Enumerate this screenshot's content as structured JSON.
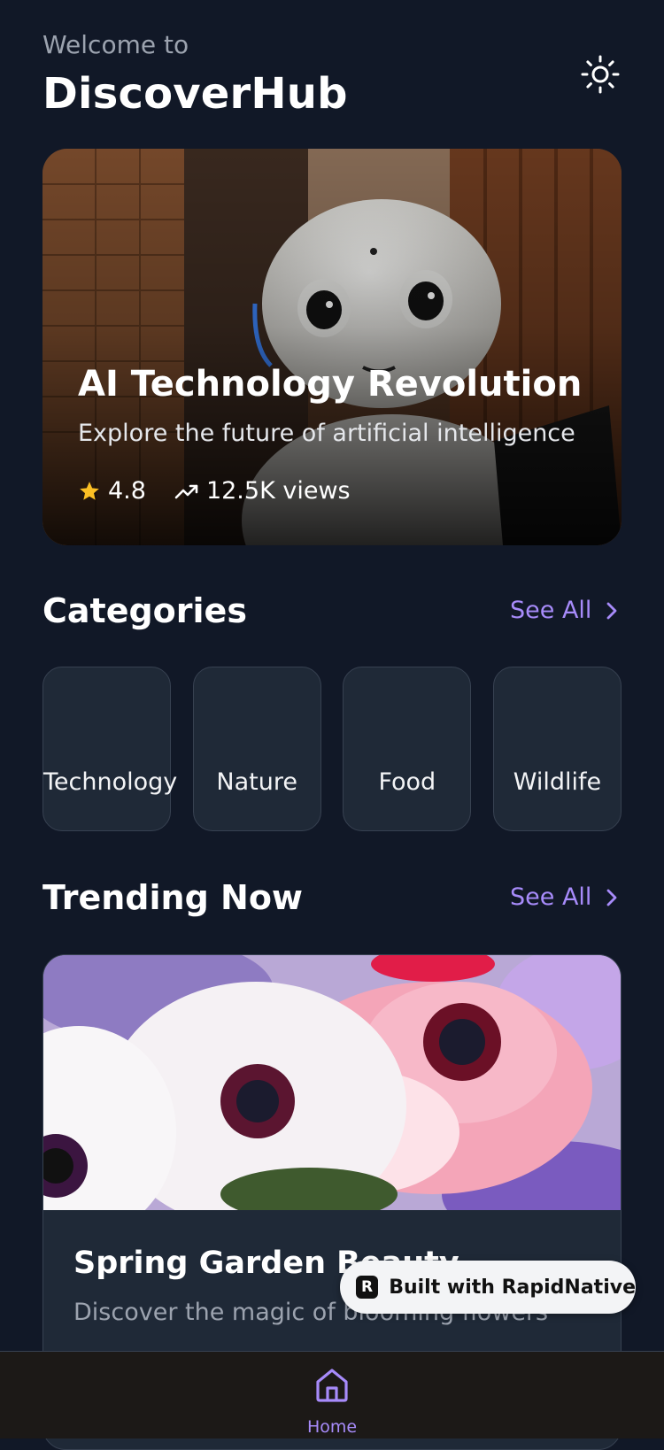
{
  "header": {
    "welcome": "Welcome to",
    "title": "DiscoverHub",
    "theme_icon": "sun-icon"
  },
  "featured": {
    "title": "AI Technology Revolution",
    "subtitle": "Explore the future of artificial intelligence",
    "rating": "4.8",
    "views": "12.5K views",
    "rating_icon": "star-icon",
    "views_icon": "trending-up-icon",
    "rating_color": "#fbbf24"
  },
  "categories": {
    "heading": "Categories",
    "see_all": "See All",
    "items": [
      {
        "label": "Technology"
      },
      {
        "label": "Nature"
      },
      {
        "label": "Food"
      },
      {
        "label": "Wildlife"
      }
    ]
  },
  "trending": {
    "heading": "Trending Now",
    "see_all": "See All",
    "card": {
      "title": "Spring Garden Beauty",
      "subtitle": "Discover the magic of blooming flowers"
    }
  },
  "badge": {
    "text": "Built with RapidNative",
    "logo_letter": "R"
  },
  "tabbar": {
    "home_label": "Home",
    "home_icon": "home-icon"
  },
  "colors": {
    "background": "#111827",
    "card": "#1f2937",
    "accent": "#a78bfa",
    "muted_text": "#9ca3af"
  }
}
